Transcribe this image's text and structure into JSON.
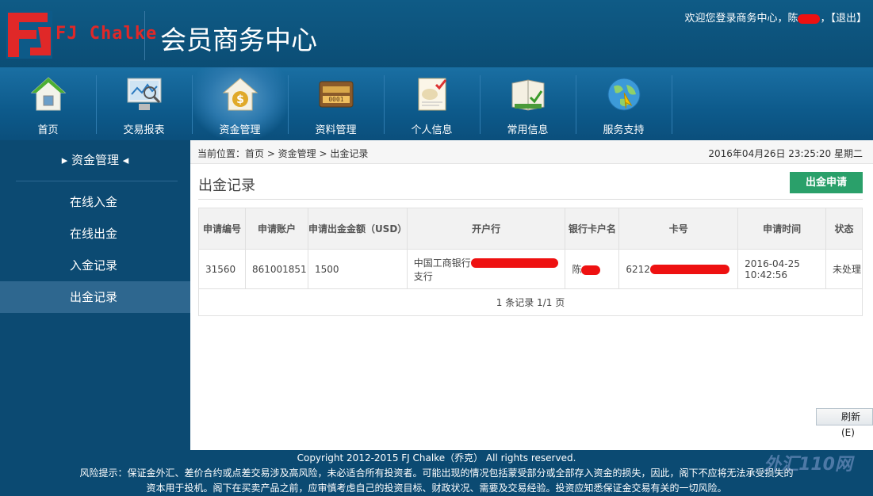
{
  "header": {
    "logo_text": "FJ Chalke",
    "title": "会员商务中心",
    "welcome_prefix": "欢迎您登录商务中心，陈",
    "welcome_sep": "，",
    "logout": "【退出】"
  },
  "nav": [
    {
      "label": "首页",
      "icon": "home-icon"
    },
    {
      "label": "交易报表",
      "icon": "report-monitor-icon"
    },
    {
      "label": "资金管理",
      "icon": "money-bag-icon"
    },
    {
      "label": "资料管理",
      "icon": "card-icon"
    },
    {
      "label": "个人信息",
      "icon": "profile-document-icon"
    },
    {
      "label": "常用信息",
      "icon": "book-check-icon"
    },
    {
      "label": "服务支持",
      "icon": "globe-icon"
    }
  ],
  "sidebar": {
    "heading": "▸ 资金管理 ◂",
    "items": [
      "在线入金",
      "在线出金",
      "入金记录",
      "出金记录"
    ]
  },
  "main": {
    "breadcrumb": "当前位置：首页 > 资金管理 > 出金记录",
    "datetime": "2016年04月26日 23:25:20 星期二",
    "page_title": "出金记录",
    "apply_button": "出金申请",
    "table": {
      "headers": [
        "申请编号",
        "申请账户",
        "申请出金金额（USD）",
        "开户行",
        "银行卡户名",
        "卡号",
        "申请时间",
        "状态"
      ],
      "rows": [
        [
          "31560",
          "861001851",
          "1500",
          "中国工商银行",
          "支行",
          "陈",
          "6212",
          "2016-04-25 10:42:56",
          "未处理"
        ]
      ],
      "footer": "1 条记录 1/1 页"
    }
  },
  "refresh_button": "刷新(E)",
  "footer": {
    "copyright": "Copyright 2012-2015 FJ Chalke（乔克） All rights reserved.",
    "risk_line1": "风险提示：保证金外汇、差价合约或点差交易涉及高风险，未必适合所有投资者。可能出现的情况包括蒙受部分或全部存入资金的损失，因此，阁下不应将无法承受损失的",
    "risk_line2": "资本用于投机。阁下在买卖产品之前，应审慎考虑自己的投资目标、财政状况、需要及交易经验。投资应知悉保证金交易有关的一切风险。"
  },
  "watermark": "外汇110网"
}
